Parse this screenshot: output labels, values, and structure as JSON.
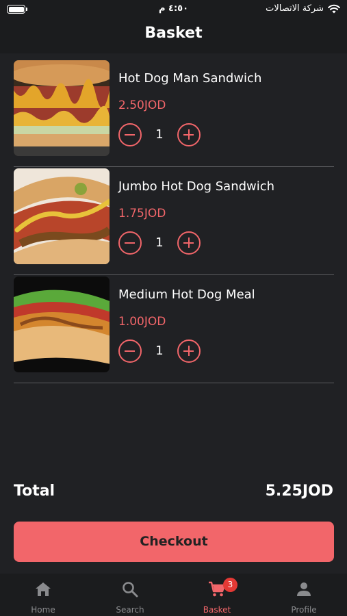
{
  "status_bar": {
    "time": "٤:٥٠ م",
    "carrier": "شركة الاتصالات"
  },
  "header": {
    "title": "Basket"
  },
  "items": [
    {
      "name": "Hot Dog Man Sandwich",
      "price": "2.50JOD",
      "quantity": "1",
      "image": "hot-dog-man-sandwich-photo"
    },
    {
      "name": "Jumbo Hot Dog Sandwich",
      "price": "1.75JOD",
      "quantity": "1",
      "image": "jumbo-hot-dog-sandwich-photo"
    },
    {
      "name": "Medium Hot Dog Meal",
      "price": "1.00JOD",
      "quantity": "1",
      "image": "medium-hot-dog-meal-photo"
    }
  ],
  "summary": {
    "total_label": "Total",
    "total_value": "5.25JOD"
  },
  "checkout_label": "Checkout",
  "tabs": [
    {
      "label": "Home",
      "icon": "home-icon"
    },
    {
      "label": "Search",
      "icon": "search-icon"
    },
    {
      "label": "Basket",
      "icon": "cart-icon",
      "badge": "3",
      "active": true
    },
    {
      "label": "Profile",
      "icon": "person-icon"
    }
  ],
  "colors": {
    "accent": "#f2666a",
    "background": "#202124",
    "header": "#1b1c1e",
    "badge": "#e53935"
  }
}
